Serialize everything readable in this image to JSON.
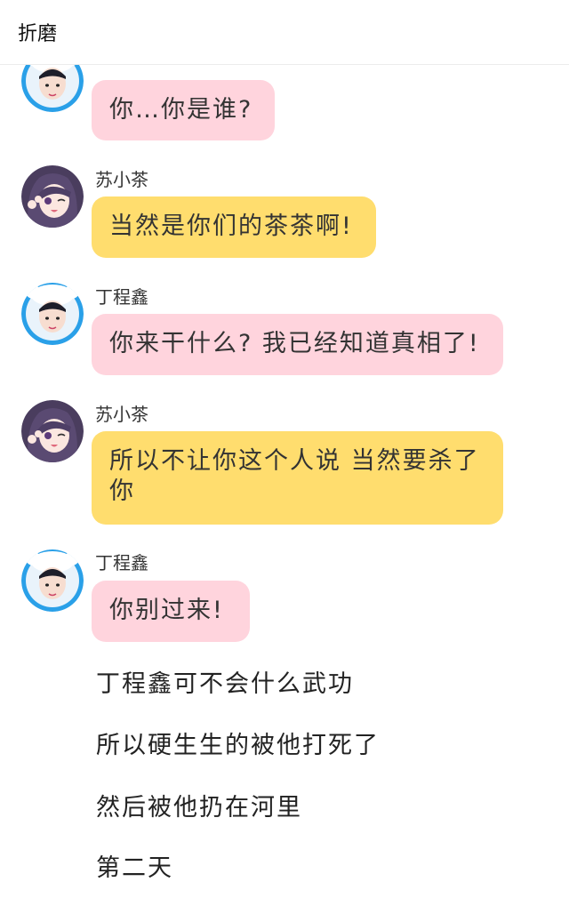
{
  "header": {
    "title": "折磨"
  },
  "colors": {
    "pink_bubble": "#ffd4dd",
    "yellow_bubble": "#ffdd6e"
  },
  "messages": [
    {
      "sender": "",
      "avatar": "boy-avatar",
      "text": "你…你是谁?"
    },
    {
      "sender": "苏小茶",
      "avatar": "girl-avatar",
      "text": "当然是你们的茶茶啊!"
    },
    {
      "sender": "丁程鑫",
      "avatar": "boy-avatar",
      "text": "你来干什么? 我已经知道真相了!"
    },
    {
      "sender": "苏小茶",
      "avatar": "girl-avatar",
      "text": "所以不让你这个人说 当然要杀了你"
    },
    {
      "sender": "丁程鑫",
      "avatar": "boy-avatar",
      "text": "你别过来!"
    }
  ],
  "narration": [
    "丁程鑫可不会什么武功",
    "所以硬生生的被他打死了",
    "然后被他扔在河里",
    "第二天"
  ]
}
